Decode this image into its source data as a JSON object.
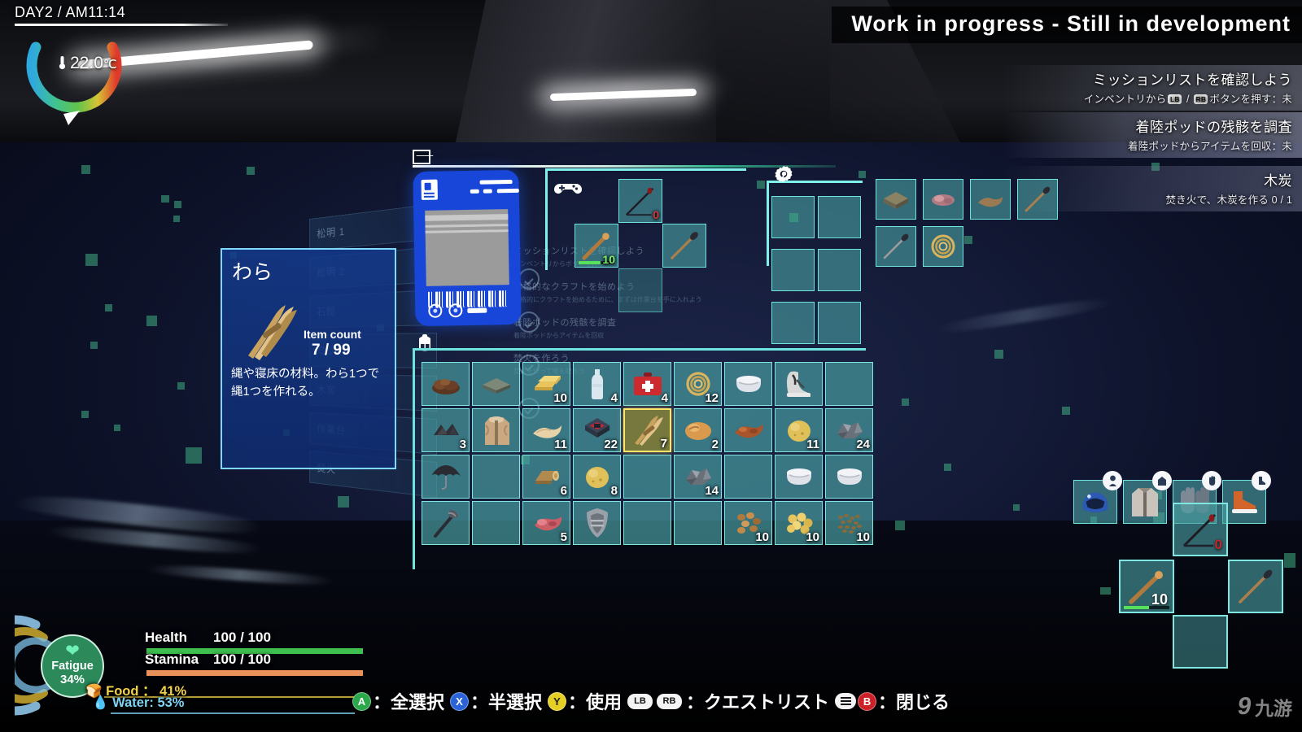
{
  "hud": {
    "day_time": "DAY2 / AM11:14",
    "temperature": "22.0",
    "temperature_unit": "℃",
    "thermometer_icon": "thermometer-icon",
    "vitals": {
      "fatigue_label": "Fatigue",
      "fatigue_value": "34%",
      "health_label": "Health",
      "health_value": "100 / 100",
      "stamina_label": "Stamina",
      "stamina_value": "100 / 100",
      "food_label": "Food ： 41%",
      "water_label": "Water: 53%"
    }
  },
  "dev_banner": "Work in progress - Still in development",
  "quests": [
    {
      "title": "ミッションリストを確認しよう",
      "sub_before": "インベントリから",
      "button_1": "LB",
      "sub_mid": " / ",
      "button_2": "RB",
      "sub_after": "ボタンを押す：未"
    },
    {
      "title": "着陸ポッドの残骸を調査",
      "sub": "着陸ポッドからアイテムを回収：未"
    },
    {
      "title": "木炭",
      "sub": "焚き火で、木炭を作る  0 / 1"
    }
  ],
  "craft_list": [
    {
      "label": "松明 1"
    },
    {
      "label": "松明 2"
    },
    {
      "label": "石槌"
    },
    {
      "label": "ミツ"
    },
    {
      "label": "木炭"
    },
    {
      "label": "作業台"
    },
    {
      "label": "焚火"
    }
  ],
  "bg_quest_list": [
    {
      "title": "ミッションリストを確認しよう",
      "desc": "インベントリからボタンを押す"
    },
    {
      "title": "本格的なクラフトを始めよう",
      "desc": "本格的にクラフトを始めるために、まずは作業台を手に入れよう"
    },
    {
      "title": "着陸ポッドの残骸を調査",
      "desc": "着陸ポッドからアイテムを回収"
    },
    {
      "title": "焚火を作ろう",
      "desc": "焚火を作って暖を取ろう"
    }
  ],
  "tooltip": {
    "name": "わら",
    "art_icon": "straw-bundle-icon",
    "count_label": "Item count",
    "count_value": "7 / 99",
    "description": "縄や寝床の材料。わら1つで\n縄1つを作れる。"
  },
  "device_card": {
    "icon": "id-card-icon",
    "barcode": "barcode-graphic"
  },
  "equipment_panel": {
    "icon": "gamepad-icon",
    "weapon_slots": [
      {
        "name": "bow",
        "icon": "bow-icon",
        "count": "0",
        "count_color": "red",
        "durability": null
      },
      {
        "name": "torch",
        "icon": "torch-icon",
        "count": "10",
        "count_color": "grn",
        "durability": 62
      },
      {
        "name": "spear",
        "icon": "spear-icon",
        "count": "",
        "count_color": "",
        "durability": null
      },
      {
        "name": "empty-slot",
        "icon": "",
        "count": "",
        "count_color": "",
        "durability": null
      }
    ],
    "armor_slots": [
      {
        "name": "helmet",
        "icon": "helmet-icon",
        "badge": "head-icon"
      },
      {
        "name": "chest",
        "icon": "jacket-icon",
        "badge": "torso-icon"
      },
      {
        "name": "gloves",
        "icon": "gloves-icon",
        "badge": "hand-icon"
      },
      {
        "name": "boots",
        "icon": "boots-icon",
        "badge": "foot-icon"
      }
    ]
  },
  "tool_panel": {
    "icon": "gear-wrench-icon",
    "slots": [
      "",
      "",
      "",
      "",
      "",
      ""
    ]
  },
  "loot_slots": [
    [
      {
        "icon": "crate-icon",
        "count": ""
      },
      {
        "icon": "meat-raw-icon",
        "count": ""
      },
      {
        "icon": "hide-icon",
        "count": ""
      },
      {
        "icon": "spear-icon",
        "count": ""
      }
    ],
    [
      {
        "icon": "spear-icon",
        "count": ""
      },
      {
        "icon": "rope-icon",
        "count": ""
      }
    ]
  ],
  "inventory": {
    "icon": "backpack-icon",
    "columns": 9,
    "rows": 4,
    "cells": [
      {
        "icon": "ember-icon",
        "count": "",
        "selected": false
      },
      {
        "icon": "stone-slab-icon",
        "count": "",
        "selected": false
      },
      {
        "icon": "gold-bar-icon",
        "count": "10",
        "selected": false
      },
      {
        "icon": "bottle-icon",
        "count": "4",
        "selected": false
      },
      {
        "icon": "medkit-icon",
        "count": "4",
        "selected": false
      },
      {
        "icon": "rope-icon",
        "count": "12",
        "selected": false
      },
      {
        "icon": "bowl-icon",
        "count": "",
        "selected": false
      },
      {
        "icon": "boots-icon",
        "count": "",
        "selected": false
      },
      {
        "icon": "",
        "count": "",
        "selected": false
      },
      {
        "icon": "charcoal-icon",
        "count": "3",
        "selected": false
      },
      {
        "icon": "fur-coat-icon",
        "count": "",
        "selected": false
      },
      {
        "icon": "cloth-icon",
        "count": "11",
        "selected": false
      },
      {
        "icon": "chip-icon",
        "count": "22",
        "selected": false
      },
      {
        "icon": "straw-bundle-icon",
        "count": "7",
        "selected": true
      },
      {
        "icon": "bread-icon",
        "count": "2",
        "selected": false
      },
      {
        "icon": "meat-cooked-icon",
        "count": "",
        "selected": false
      },
      {
        "icon": "potato-icon",
        "count": "11",
        "selected": false
      },
      {
        "icon": "ore-icon",
        "count": "24",
        "selected": false
      },
      {
        "icon": "umbrella-icon",
        "count": "",
        "selected": false
      },
      {
        "icon": "",
        "count": "",
        "selected": false
      },
      {
        "icon": "log-icon",
        "count": "6",
        "selected": false
      },
      {
        "icon": "potato-icon",
        "count": "8",
        "selected": false
      },
      {
        "icon": "",
        "count": "",
        "selected": false
      },
      {
        "icon": "ore-icon",
        "count": "14",
        "selected": false
      },
      {
        "icon": "",
        "count": "",
        "selected": false
      },
      {
        "icon": "bowl-icon",
        "count": "",
        "selected": false
      },
      {
        "icon": "bowl-icon",
        "count": "",
        "selected": false
      },
      {
        "icon": "axe-icon",
        "count": "",
        "selected": false
      },
      {
        "icon": "",
        "count": "",
        "selected": false
      },
      {
        "icon": "raw-meat-icon",
        "count": "5",
        "selected": false
      },
      {
        "icon": "armor-plate-icon",
        "count": "",
        "selected": false
      },
      {
        "icon": "",
        "count": "",
        "selected": false
      },
      {
        "icon": "",
        "count": "",
        "selected": false
      },
      {
        "icon": "nuts-icon",
        "count": "10",
        "selected": false
      },
      {
        "icon": "berries-icon",
        "count": "10",
        "selected": false
      },
      {
        "icon": "seeds-icon",
        "count": "10",
        "selected": false
      }
    ]
  },
  "weapon_wheel": [
    {
      "position": "top",
      "icon": "bow-icon",
      "count": "0",
      "count_color": "red"
    },
    {
      "position": "left",
      "icon": "torch-icon",
      "count": "10",
      "count_color": ""
    },
    {
      "position": "right",
      "icon": "spear-icon",
      "count": "",
      "count_color": ""
    },
    {
      "position": "bottom",
      "icon": "",
      "count": "",
      "count_color": ""
    }
  ],
  "controls": [
    {
      "button": "A",
      "type": "face",
      "label": "：全選択"
    },
    {
      "button": "X",
      "type": "face",
      "label": "：半選択"
    },
    {
      "button": "Y",
      "type": "face",
      "label": "：使用"
    },
    {
      "button": "LB",
      "button2": "RB",
      "type": "bumper",
      "label": "：クエストリスト"
    },
    {
      "button": "≡",
      "button2": "B",
      "type": "menu",
      "label": "：閉じる"
    }
  ],
  "watermark": {
    "mark": "9",
    "text": "九游"
  },
  "colors": {
    "accent_cyan": "#6fe3de",
    "slot_fill": "#4aa0a3",
    "selected_yellow": "#ffe66a",
    "health_green": "#3fbf4f",
    "stamina_orange": "#e8915a",
    "food_yellow": "#f2d24a",
    "water_blue": "#7fd4f5",
    "device_blue": "#1846d8",
    "tooltip_blue": "#143a8c"
  }
}
